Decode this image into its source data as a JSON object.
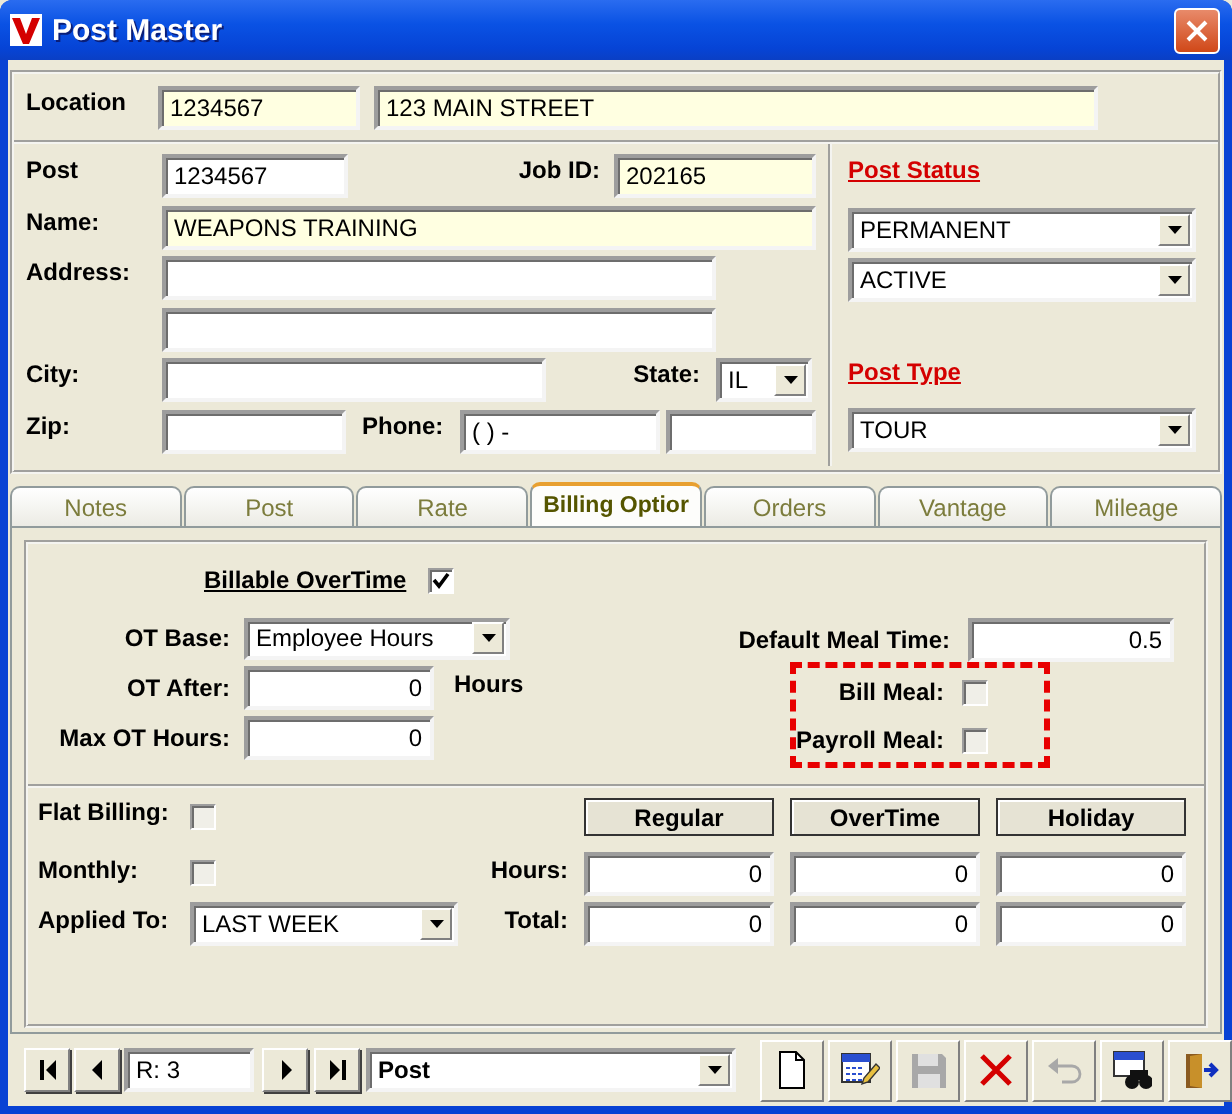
{
  "window": {
    "title": "Post Master"
  },
  "location": {
    "label": "Location",
    "code": "1234567",
    "address": "123 MAIN STREET"
  },
  "post": {
    "post_label": "Post",
    "post_value": "1234567",
    "job_id_label": "Job ID:",
    "job_id_value": "202165",
    "name_label": "Name:",
    "name_value": "WEAPONS TRAINING",
    "address_label": "Address:",
    "city_label": "City:",
    "state_label": "State:",
    "state_value": "IL",
    "zip_label": "Zip:",
    "phone_label": "Phone:",
    "phone_value": "(  )   -"
  },
  "post_status": {
    "label": "Post Status",
    "status": "PERMANENT",
    "activity": "ACTIVE"
  },
  "post_type": {
    "label": "Post Type",
    "value": "TOUR"
  },
  "tabs": [
    {
      "label": "Notes",
      "selected": false
    },
    {
      "label": "Post",
      "selected": false
    },
    {
      "label": "Rate",
      "selected": false
    },
    {
      "label": "Billing Optior",
      "selected": true
    },
    {
      "label": "Orders",
      "selected": false
    },
    {
      "label": "Vantage",
      "selected": false
    },
    {
      "label": "Mileage",
      "selected": false
    }
  ],
  "billing": {
    "billable_overtime": {
      "label": "Billable OverTime",
      "checked": true
    },
    "ot_base": {
      "label": "OT Base:",
      "value": "Employee Hours"
    },
    "ot_after": {
      "label": "OT After:",
      "value": "0",
      "unit": "Hours"
    },
    "max_ot_hours": {
      "label": "Max OT Hours:",
      "value": "0"
    },
    "default_meal_time": {
      "label": "Default Meal Time:",
      "value": "0.5"
    },
    "meals": [
      {
        "label": "Bill Meal:",
        "checked": false
      },
      {
        "label": "Payroll Meal:",
        "checked": false
      }
    ],
    "flat_billing": {
      "label": "Flat Billing:",
      "checked": false
    },
    "monthly": {
      "label": "Monthly:",
      "checked": false
    },
    "applied_to": {
      "label": "Applied To:",
      "value": "LAST WEEK"
    },
    "rate_table": {
      "columns": [
        "Regular",
        "OverTime",
        "Holiday"
      ],
      "rows": [
        {
          "label": "Hours:",
          "values": [
            "0",
            "0",
            "0"
          ]
        },
        {
          "label": "Total:",
          "values": [
            "0",
            "0",
            "0"
          ]
        }
      ]
    }
  },
  "navigator": {
    "back_buttons": [
      {
        "kind": "first"
      },
      {
        "kind": "previous"
      }
    ],
    "record": "R: 3",
    "forward_buttons": [
      {
        "kind": "next"
      },
      {
        "kind": "last"
      }
    ],
    "table": "Post"
  },
  "toolbar": [
    {
      "kind": "new",
      "disabled": false
    },
    {
      "kind": "edit",
      "disabled": false
    },
    {
      "kind": "save",
      "disabled": true
    },
    {
      "kind": "delete",
      "disabled": false
    },
    {
      "kind": "undo",
      "disabled": true
    },
    {
      "kind": "find",
      "disabled": false
    },
    {
      "kind": "exit",
      "disabled": false
    }
  ]
}
